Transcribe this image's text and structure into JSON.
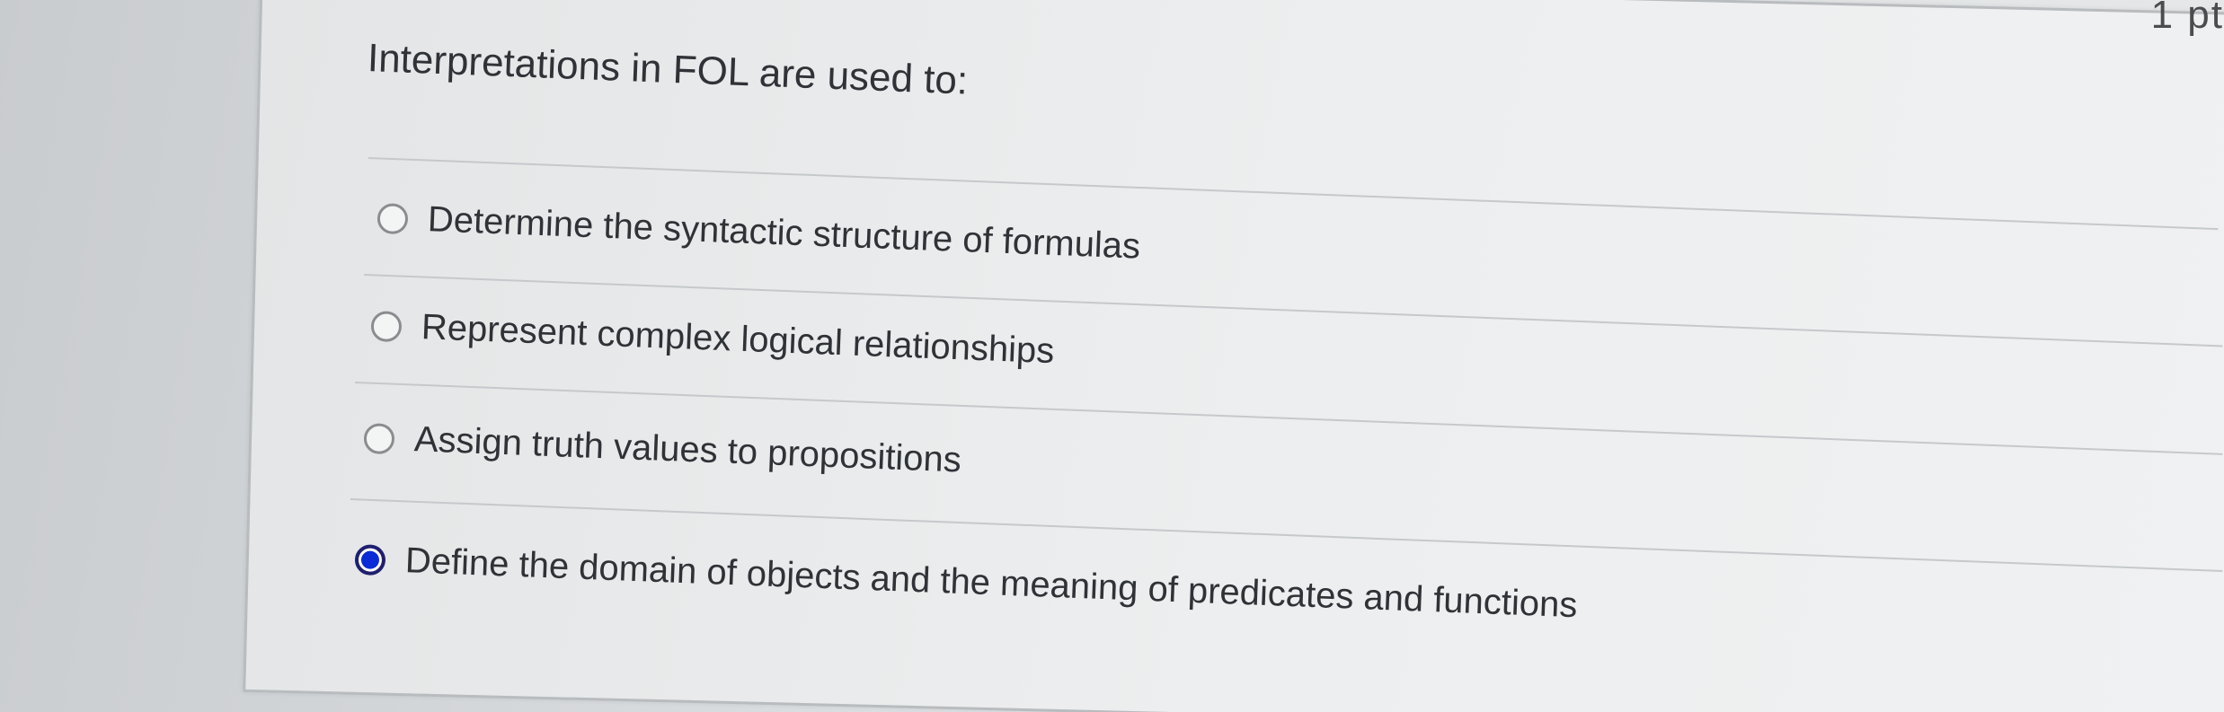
{
  "question": {
    "points": "1 pt",
    "prompt": "Interpretations in FOL are used to:"
  },
  "answers": [
    {
      "label": "Determine the syntactic structure of formulas",
      "selected": false
    },
    {
      "label": "Represent complex logical relationships",
      "selected": false
    },
    {
      "label": "Assign truth values to propositions",
      "selected": false
    },
    {
      "label": "Define the domain of objects and the meaning of predicates and functions",
      "selected": true
    }
  ],
  "colors": {
    "selected_radio": "#0a2bd6",
    "text": "#2f3236"
  }
}
